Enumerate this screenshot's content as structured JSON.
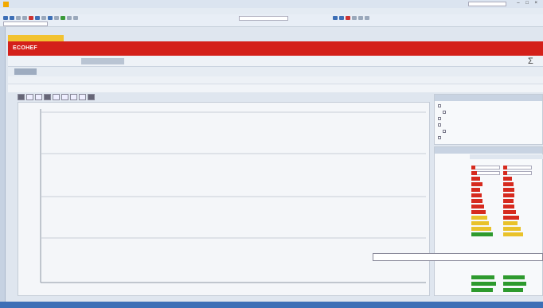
{
  "titlebar": {
    "title": "",
    "search_placeholder": "",
    "window_controls": "– □ ×"
  },
  "menu": [],
  "toolbar": {
    "combo_filter": "",
    "combo_target": ""
  },
  "left_strip_label": "",
  "document_tab": "",
  "banner": {
    "brand": "ECOHEF",
    "subtitle": ""
  },
  "view_tabs": [
    {
      "label": "",
      "active": false
    },
    {
      "label": "",
      "active": false
    },
    {
      "label": "",
      "active": true
    },
    {
      "label": "",
      "active": false
    },
    {
      "label": "",
      "active": false
    }
  ],
  "sigma": "Σ",
  "sigma_label": "",
  "sub_tabs": [
    {
      "label": "",
      "active": true
    },
    {
      "label": "",
      "active": false
    }
  ],
  "pane_headers": {
    "left": "",
    "right": ""
  },
  "tc_hints": {
    "left": "",
    "right": ""
  },
  "chart": {
    "ylabel": "",
    "xlabel": ""
  },
  "filters": {
    "header": "",
    "options": [
      {
        "label": "",
        "checked": false
      },
      {
        "label": "",
        "checked": false
      },
      {
        "label": "",
        "checked": false
      },
      {
        "label": "",
        "checked": false
      },
      {
        "label": "",
        "checked": false
      },
      {
        "label": "",
        "checked": false
      }
    ]
  },
  "table": {
    "header": "",
    "subheader": "",
    "columns": [
      "",
      "",
      "",
      ""
    ],
    "rows": [
      {
        "time": "",
        "a": 0.15,
        "b": 0.15,
        "colorA": "#d62a1e",
        "colorB": "#d62a1e",
        "boxed": true
      },
      {
        "time": "",
        "a": 0.2,
        "b": 0.15,
        "colorA": "#d62a1e",
        "colorB": "#d62a1e",
        "boxed": true
      },
      {
        "time": "",
        "a": 0.3,
        "b": 0.3,
        "colorA": "#d62a1e",
        "colorB": "#d62a1e",
        "boxed": false
      },
      {
        "time": "",
        "a": 0.4,
        "b": 0.35,
        "colorA": "#d62a1e",
        "colorB": "#d62a1e",
        "boxed": false
      },
      {
        "time": "",
        "a": 0.3,
        "b": 0.4,
        "colorA": "#d62a1e",
        "colorB": "#d62a1e",
        "boxed": false
      },
      {
        "time": "",
        "a": 0.35,
        "b": 0.4,
        "colorA": "#d62a1e",
        "colorB": "#d62a1e",
        "boxed": false
      },
      {
        "time": "",
        "a": 0.4,
        "b": 0.35,
        "colorA": "#d62a1e",
        "colorB": "#d62a1e",
        "boxed": false
      },
      {
        "time": "",
        "a": 0.45,
        "b": 0.4,
        "colorA": "#d62a1e",
        "colorB": "#d62a1e",
        "boxed": false
      },
      {
        "time": "",
        "a": 0.5,
        "b": 0.45,
        "colorA": "#d62a1e",
        "colorB": "#d62a1e",
        "boxed": false
      },
      {
        "time": "",
        "a": 0.55,
        "b": 0.55,
        "colorA": "#e9c22a",
        "colorB": "#d62a1e",
        "boxed": false
      },
      {
        "time": "",
        "a": 0.6,
        "b": 0.5,
        "colorA": "#e9c22a",
        "colorB": "#e9c22a",
        "boxed": false
      },
      {
        "time": "",
        "a": 0.7,
        "b": 0.6,
        "colorA": "#e9c22a",
        "colorB": "#e9c22a",
        "boxed": false
      },
      {
        "time": "",
        "a": 0.75,
        "b": 0.7,
        "colorA": "#2e9a2e",
        "colorB": "#e9c22a",
        "boxed": false
      }
    ],
    "rows_lower": [
      {
        "time": "",
        "a": 0.8,
        "b": 0.75,
        "colorA": "#2e9a2e",
        "colorB": "#2e9a2e"
      },
      {
        "time": "",
        "a": 0.85,
        "b": 0.8,
        "colorA": "#2e9a2e",
        "colorB": "#2e9a2e"
      },
      {
        "time": "",
        "a": 0.75,
        "b": 0.7,
        "colorA": "#2e9a2e",
        "colorB": "#2e9a2e"
      }
    ]
  },
  "tooltip": {
    "line1": "",
    "line2": ""
  },
  "status": ""
}
